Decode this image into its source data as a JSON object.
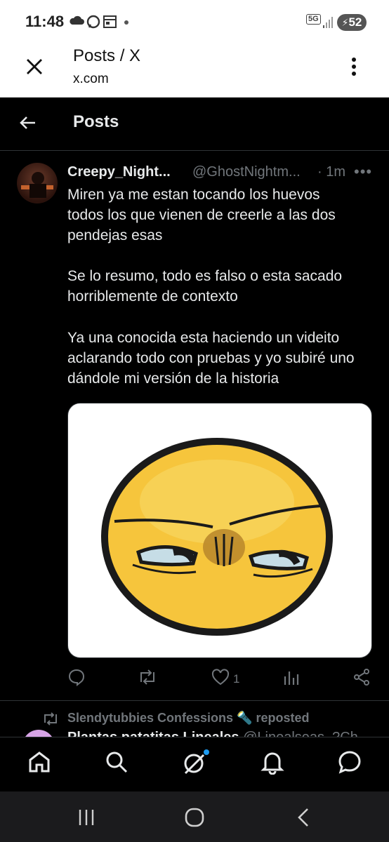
{
  "status_bar": {
    "time": "11:48",
    "battery": "52",
    "network": "5G",
    "icons": [
      "cloud-icon",
      "whatsapp-icon",
      "calendar-icon",
      "dot-icon",
      "network-5g-icon",
      "signal-icon",
      "battery-icon"
    ]
  },
  "browser": {
    "title": "Posts / X",
    "url": "x.com",
    "close_icon": "close-icon",
    "menu_icon": "more-vert-icon"
  },
  "header": {
    "title": "Posts",
    "back_icon": "arrow-left-icon"
  },
  "tweet": {
    "author": "Creepy_Night...",
    "handle": "@GhostNightm...",
    "time": "· 1m",
    "more": "•••",
    "lines": [
      "Miren ya me estan tocando los huevos",
      "todos los que vienen de creerle a las dos",
      "pendejas esas",
      "Se lo resumo, todo es falso o esta sacado",
      "horriblemente de contexto",
      "Ya una conocida esta haciendo un videito",
      "aclarando todo con pruebas y yo subiré uno",
      "dándole mi versión de la historia"
    ],
    "media": "squinting-emoji-image",
    "likes": "1",
    "actions": [
      "reply-icon",
      "repost-icon",
      "like-icon",
      "views-icon",
      "share-icon"
    ]
  },
  "next": {
    "repost_text": "Slendytubbies Confessions 🔦 reposted",
    "name_partial": "Plantas patatitas Lineales",
    "handle_partial": "@Linealseas_?Ch..."
  },
  "bottom_nav": [
    "home-icon",
    "search-icon",
    "grok-icon",
    "notifications-icon",
    "messages-icon"
  ],
  "colors": {
    "accent": "#1d9bf0",
    "text": "#e7e9ea",
    "muted": "#71767b",
    "bg": "#000000"
  }
}
